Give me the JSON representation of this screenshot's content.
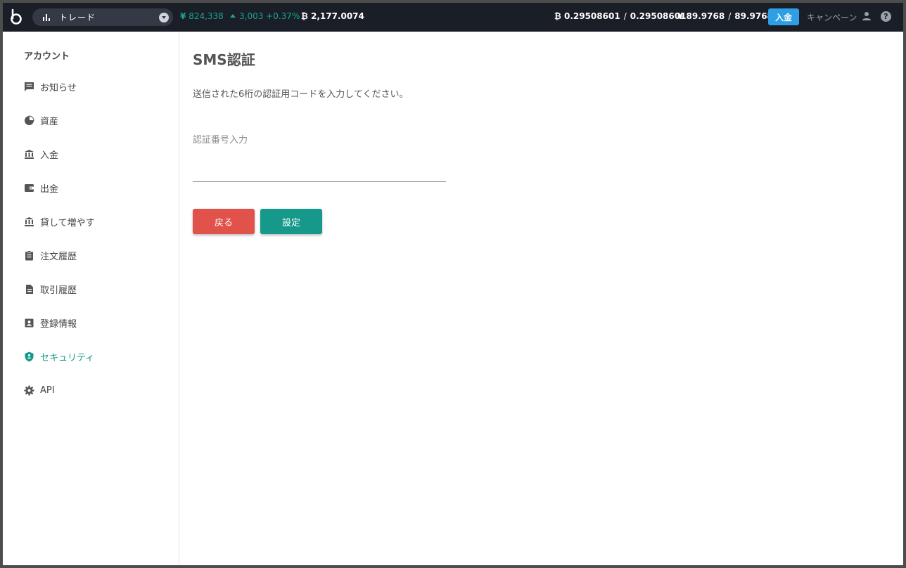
{
  "topbar": {
    "trade_label": "トレード",
    "jpy_price": "824,338",
    "jpy_symbol": "¥",
    "change": "3,003 +0.37%",
    "btc_symbol": "₿",
    "btc_volume": "2,177.0074",
    "btc_balance_available": "0.29508601",
    "btc_balance_total": "0.29508601",
    "jpy_balance_available": "89.9768",
    "jpy_balance_total": "89.9768",
    "slash": "/",
    "deposit_label": "入金",
    "campaign_label": "キャンペーン",
    "help_glyph": "?"
  },
  "sidebar": {
    "title": "アカウント",
    "items": [
      {
        "label": "お知らせ",
        "icon": "message-icon"
      },
      {
        "label": "資産",
        "icon": "pie-chart-icon"
      },
      {
        "label": "入金",
        "icon": "bank-icon"
      },
      {
        "label": "出金",
        "icon": "wallet-icon"
      },
      {
        "label": "貸して増やす",
        "icon": "bank-icon"
      },
      {
        "label": "注文履歴",
        "icon": "clipboard-icon"
      },
      {
        "label": "取引履歴",
        "icon": "document-icon"
      },
      {
        "label": "登録情報",
        "icon": "contact-card-icon"
      },
      {
        "label": "セキュリティ",
        "icon": "shield-icon",
        "active": true
      },
      {
        "label": "API",
        "icon": "gear-icon"
      }
    ]
  },
  "main": {
    "title": "SMS認証",
    "instruction": "送信された6桁の認証用コードを入力してください。",
    "field_label": "認証番号入力",
    "field_value": "",
    "back_label": "戻る",
    "submit_label": "設定"
  },
  "colors": {
    "accent": "#16998a",
    "danger": "#e0524a",
    "deposit": "#2e9ee5",
    "topbar_bg": "#1a1e27"
  }
}
